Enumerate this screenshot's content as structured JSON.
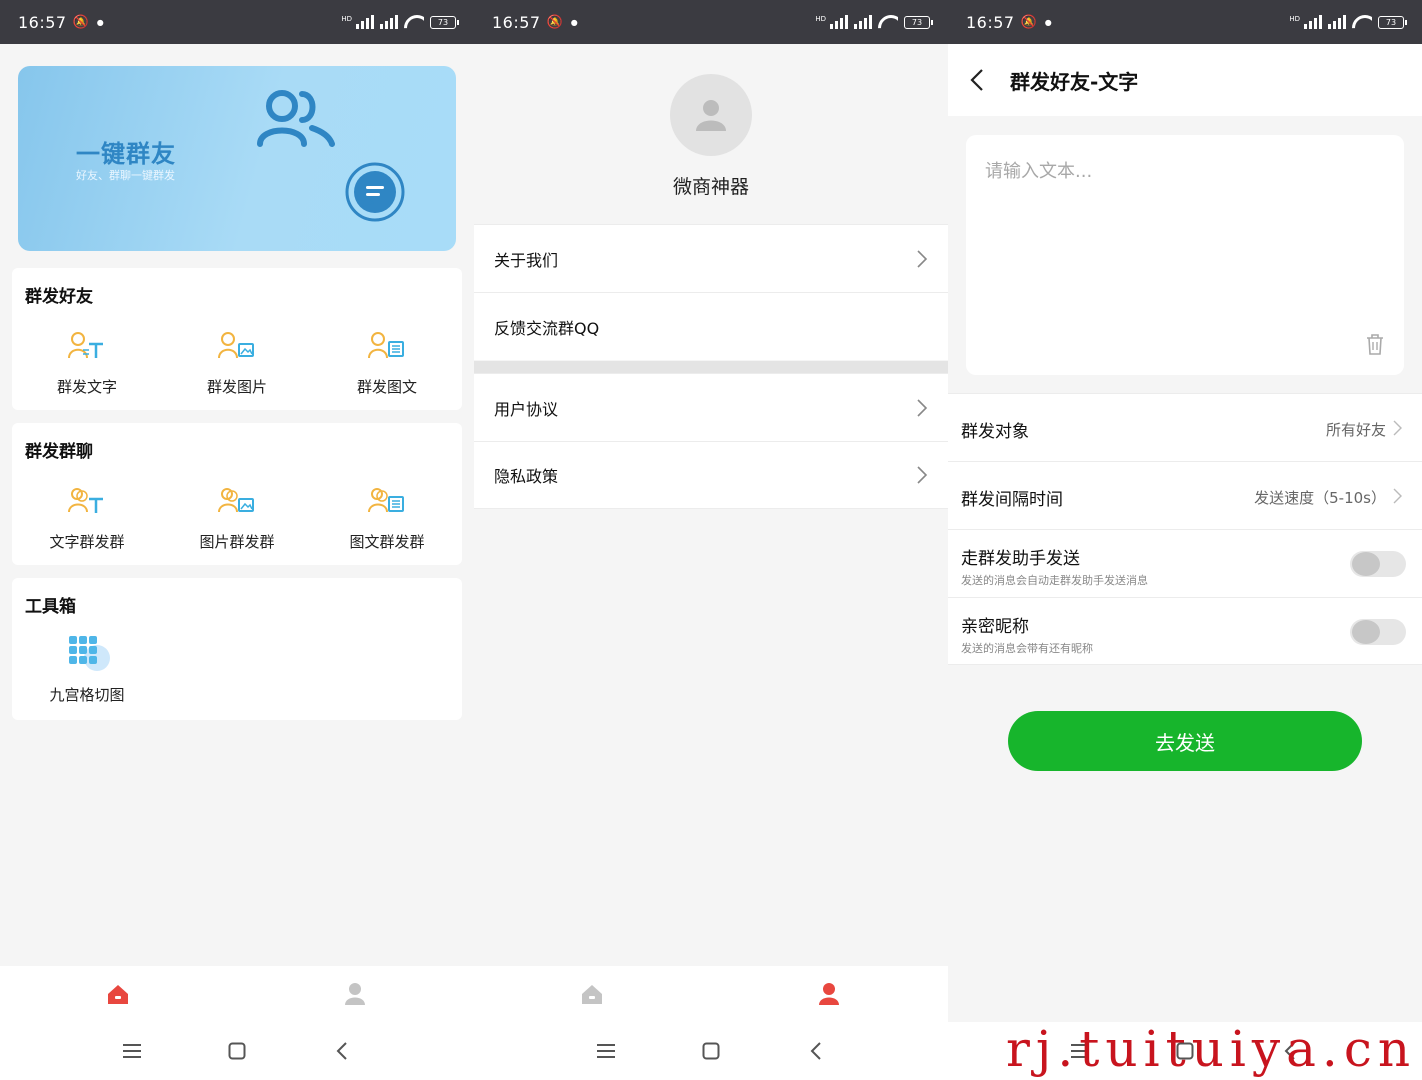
{
  "status": {
    "time": "16:57",
    "battery": "73",
    "hd": "HD"
  },
  "home": {
    "banner": {
      "title": "一键群友",
      "subtitle": "好友、群聊一键群发"
    },
    "friends_section": {
      "title": "群发好友",
      "items": [
        {
          "label": "群发文字",
          "icon": "user-text-icon"
        },
        {
          "label": "群发图片",
          "icon": "user-image-icon"
        },
        {
          "label": "群发图文",
          "icon": "user-article-icon"
        }
      ]
    },
    "groups_section": {
      "title": "群发群聊",
      "items": [
        {
          "label": "文字群发群",
          "icon": "group-text-icon"
        },
        {
          "label": "图片群发群",
          "icon": "group-image-icon"
        },
        {
          "label": "图文群发群",
          "icon": "group-article-icon"
        }
      ]
    },
    "tools_section": {
      "title": "工具箱",
      "items": [
        {
          "label": "九宫格切图",
          "icon": "grid-nine-icon"
        }
      ]
    }
  },
  "profile": {
    "app_name": "微商神器",
    "menu": [
      {
        "label": "关于我们"
      },
      {
        "label": "反馈交流群QQ"
      },
      {
        "label": "用户协议"
      },
      {
        "label": "隐私政策"
      }
    ]
  },
  "compose": {
    "title": "群发好友-文字",
    "placeholder": "请输入文本...",
    "target_label": "群发对象",
    "target_value": "所有好友",
    "interval_label": "群发间隔时间",
    "interval_value": "发送速度（5-10s）",
    "helper_label": "走群发助手发送",
    "helper_desc": "发送的消息会自动走群发助手发送消息",
    "nickname_label": "亲密昵称",
    "nickname_desc": "发送的消息会带有还有昵称",
    "helper_on": false,
    "nickname_on": false,
    "send_label": "去发送"
  },
  "colors": {
    "accent_red": "#e8473f",
    "send_green": "#17b52c",
    "banner_blue": "#2f86c4"
  },
  "watermark": "rj.tuituiya.cn"
}
